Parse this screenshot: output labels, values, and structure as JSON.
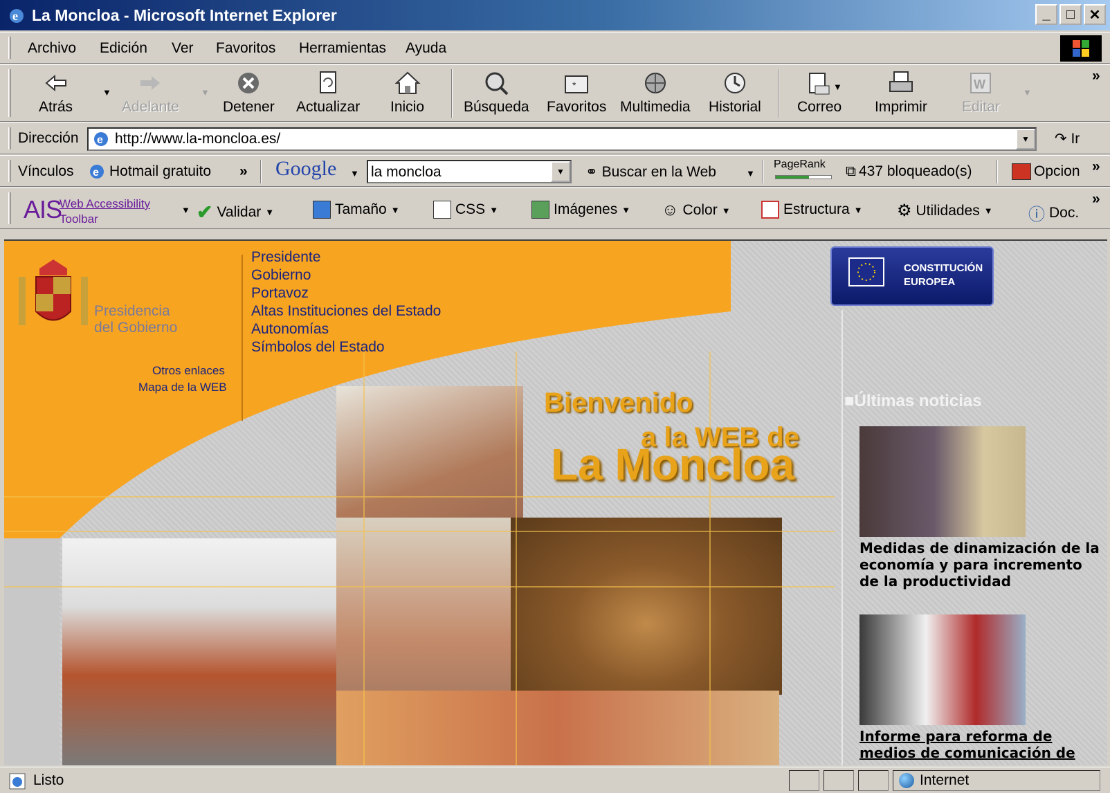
{
  "window": {
    "title": "La Moncloa - Microsoft Internet Explorer",
    "min": "_",
    "max": "□",
    "close": "✕"
  },
  "menu": [
    "Archivo",
    "Edición",
    "Ver",
    "Favoritos",
    "Herramientas",
    "Ayuda"
  ],
  "toolbar": {
    "back": "Atrás",
    "forward": "Adelante",
    "stop": "Detener",
    "refresh": "Actualizar",
    "home": "Inicio",
    "search": "Búsqueda",
    "favorites": "Favoritos",
    "media": "Multimedia",
    "history": "Historial",
    "mail": "Correo",
    "print": "Imprimir",
    "edit": "Editar",
    "more": "»"
  },
  "address": {
    "label": "Dirección",
    "url": "http://www.la-moncloa.es/",
    "go": "Ir"
  },
  "links": {
    "label": "Vínculos",
    "hotmail": "Hotmail gratuito",
    "more": "»",
    "google_logo": "Google",
    "google_query": "la moncloa",
    "search_web": "Buscar en la Web",
    "pagerank": "PageRank",
    "blocked": "437 bloqueado(s)",
    "options": "Opcion",
    "more2": "»"
  },
  "ais": {
    "logo": "AIS",
    "line1": "Web Accessibility",
    "line2": "Toolbar",
    "items": [
      "Validar",
      "Tamaño",
      "CSS",
      "Imágenes",
      "Color",
      "Estructura",
      "Utilidades",
      "Doc."
    ],
    "more": "»"
  },
  "page": {
    "presidencia": [
      "Presidencia",
      "del Gobierno"
    ],
    "nav": [
      "Presidente",
      "Gobierno",
      "Portavoz",
      "Altas Instituciones del Estado",
      "Autonomías",
      "Símbolos del Estado"
    ],
    "small_links": [
      "Otros enlaces",
      "Mapa de la WEB"
    ],
    "eu": [
      "CONSTITUCIÓN",
      "EUROPEA"
    ],
    "welcome": [
      "Bienvenido",
      "a la WEB de",
      "La Moncloa"
    ],
    "news_heading": "Últimas noticias",
    "news": [
      {
        "title": "Medidas de dinamización de la economía y para incremento de la productividad"
      },
      {
        "title": "Informe para reforma de medios de comunicación de"
      }
    ]
  },
  "status": {
    "text": "Listo",
    "zone": "Internet"
  },
  "colors": {
    "orange": "#f7a421",
    "nav_blue": "#1a237e",
    "title_blue": "#0a246a"
  }
}
